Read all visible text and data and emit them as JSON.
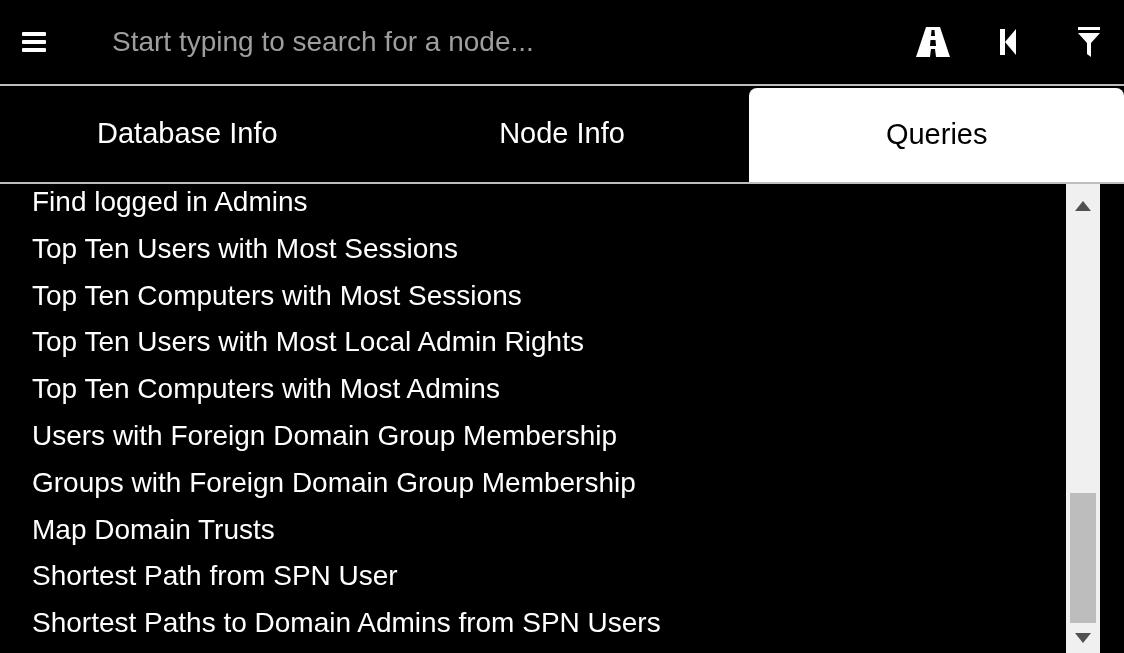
{
  "search": {
    "placeholder": "Start typing to search for a node..."
  },
  "tabs": [
    {
      "label": "Database Info",
      "selected": false
    },
    {
      "label": "Node Info",
      "selected": false
    },
    {
      "label": "Queries",
      "selected": true
    }
  ],
  "queries": [
    "Find logged in Admins",
    "Top Ten Users with Most Sessions",
    "Top Ten Computers with Most Sessions",
    "Top Ten Users with Most Local Admin Rights",
    "Top Ten Computers with Most Admins",
    "Users with Foreign Domain Group Membership",
    "Groups with Foreign Domain Group Membership",
    "Map Domain Trusts",
    "Shortest Path from SPN User",
    "Shortest Paths to Domain Admins from SPN Users"
  ]
}
